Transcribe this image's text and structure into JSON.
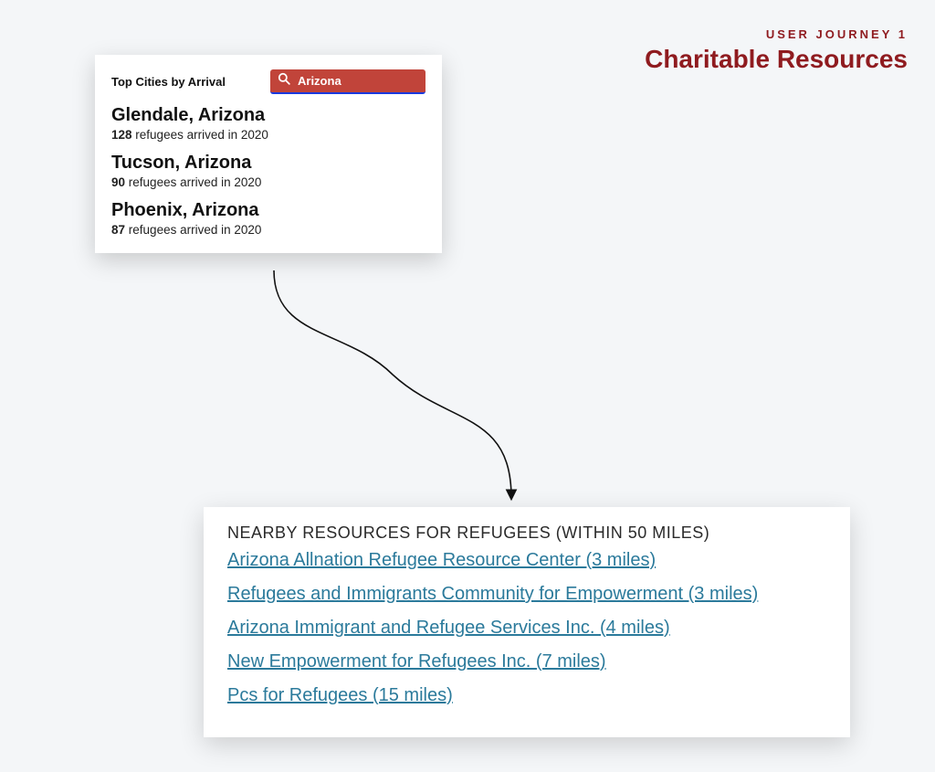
{
  "header": {
    "eyebrow": "USER JOURNEY 1",
    "title": "Charitable Resources"
  },
  "top_card": {
    "title": "Top Cities by Arrival",
    "search_value": "Arizona",
    "stat_suffix": "refugees arrived in 2020",
    "cities": [
      {
        "name": "Glendale, Arizona",
        "count": "128"
      },
      {
        "name": "Tucson, Arizona",
        "count": "90"
      },
      {
        "name": "Phoenix, Arizona",
        "count": "87"
      }
    ]
  },
  "bottom_card": {
    "title": "NEARBY RESOURCES FOR REFUGEES (WITHIN 50 MILES)",
    "resources": [
      "Arizona Allnation Refugee Resource Center (3 miles)",
      "Refugees and Immigrants Community for Empowerment (3 miles)",
      "Arizona Immigrant and Refugee Services Inc. (4 miles)",
      "New Empowerment for Refugees Inc. (7 miles)",
      "Pcs for Refugees (15 miles)"
    ]
  }
}
